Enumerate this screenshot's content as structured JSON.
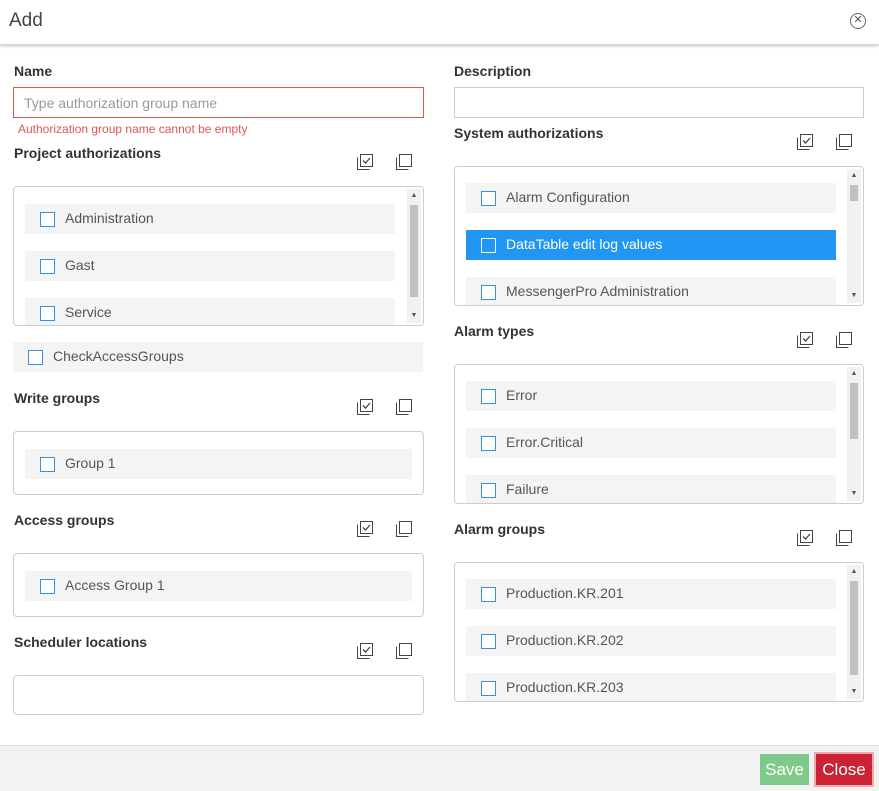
{
  "dialog": {
    "title": "Add"
  },
  "name": {
    "label": "Name",
    "placeholder": "Type authorization group name",
    "value": "",
    "error": "Authorization group name cannot be empty"
  },
  "description": {
    "label": "Description",
    "value": ""
  },
  "project_authorizations": {
    "label": "Project authorizations",
    "items": [
      "Administration",
      "Gast",
      "Service"
    ],
    "extra_item": "CheckAccessGroups"
  },
  "write_groups": {
    "label": "Write groups",
    "items": [
      "Group 1"
    ]
  },
  "access_groups": {
    "label": "Access groups",
    "items": [
      "Access Group 1"
    ]
  },
  "scheduler_locations": {
    "label": "Scheduler locations",
    "items": []
  },
  "system_authorizations": {
    "label": "System authorizations",
    "items": [
      "Alarm Configuration",
      "DataTable edit log values",
      "MessengerPro Administration"
    ],
    "selected": "DataTable edit log values"
  },
  "alarm_types": {
    "label": "Alarm types",
    "items": [
      "Error",
      "Error.Critical",
      "Failure"
    ]
  },
  "alarm_groups": {
    "label": "Alarm groups",
    "items": [
      "Production.KR.201",
      "Production.KR.202",
      "Production.KR.203"
    ]
  },
  "footer": {
    "save_label": "Save",
    "close_label": "Close"
  },
  "colors": {
    "accent": "#2196f3",
    "error": "#e0574f",
    "save": "#7fca8a",
    "close": "#cc2233",
    "checkbox_border": "#3b8fd6"
  },
  "icons": {
    "close": "close-circle-icon",
    "select_all": "select-all-icon",
    "copy": "copy-icon",
    "scroll_up": "scroll-up-arrow-icon",
    "scroll_down": "scroll-down-arrow-icon"
  }
}
